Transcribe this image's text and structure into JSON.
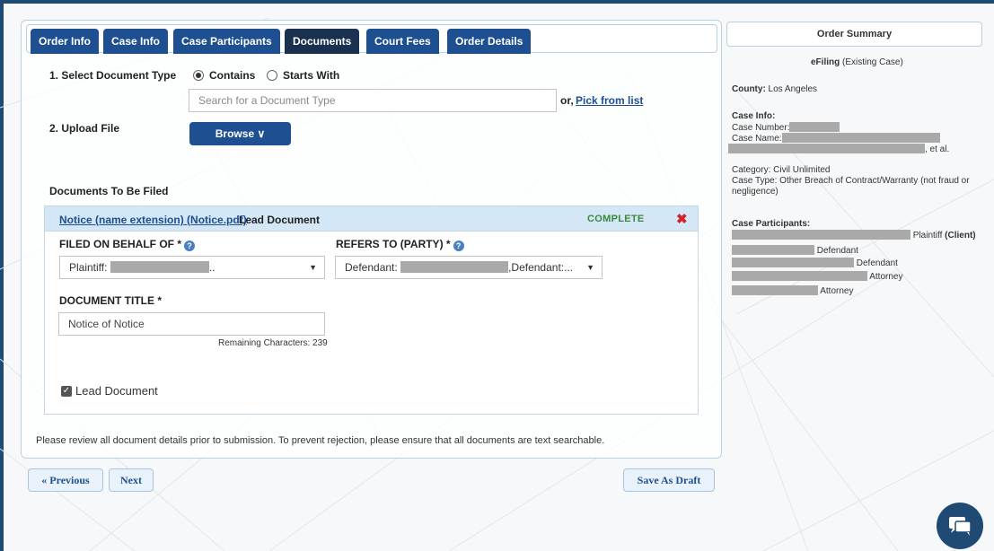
{
  "tabs": [
    {
      "label": "Order Info"
    },
    {
      "label": "Case Info"
    },
    {
      "label": "Case Participants"
    },
    {
      "label": "Documents"
    },
    {
      "label": "Court Fees"
    },
    {
      "label": "Order Details"
    }
  ],
  "active_tab": "Documents",
  "select_doc": {
    "label": "1. Select Document Type",
    "option_contains": "Contains",
    "option_starts_with": "Starts With",
    "search_placeholder": "Search for a Document Type",
    "or_text": "or,",
    "pick_link": "Pick from list"
  },
  "upload": {
    "label": "2. Upload File",
    "browse_label": "Browse ∨"
  },
  "documents": {
    "heading": "Documents To Be Filed",
    "item": {
      "file_link": "Notice (name extension) (Notice.pdf)",
      "lead_text": "Lead Document",
      "status": "COMPLETE",
      "remove_icon": "✖",
      "filed_on_behalf_label": "FILED ON BEHALF OF *",
      "filed_on_behalf_prefix": "Plaintiff:",
      "filed_on_behalf_suffix": "..",
      "refers_to_label": "REFERS TO (PARTY) *",
      "refers_to_prefix": "Defendant:",
      "refers_to_suffix": ",Defendant:...",
      "title_label": "DOCUMENT TITLE *",
      "title_value": "Notice of Notice",
      "remaining": "Remaining Characters: 239",
      "lead_checkbox_label": "Lead Document"
    }
  },
  "notice": "Please review all document details prior to submission. To prevent rejection, please ensure that all documents are text searchable.",
  "nav": {
    "previous": "« Previous",
    "next": "Next",
    "save_draft": "Save As Draft"
  },
  "summary": {
    "title": "Order Summary",
    "efiling_bold": "eFiling",
    "efiling_rest": " (Existing Case)",
    "county_label": "County:",
    "county_value": " Los Angeles",
    "case_info_label": "Case Info:",
    "case_number": "Case Number:",
    "case_name": "Case Name:",
    "et_al": ", et al.",
    "category": "Category: Civil Unlimited",
    "case_type_1": "Case Type: Other Breach of Contract/Warranty (not fraud or",
    "case_type_2": "negligence)",
    "participants_label": "Case Participants:",
    "p1_role": " Plaintiff ",
    "p1_client": "(Client)",
    "p2_role": " Defendant",
    "p3_role": " Defendant",
    "p4_role": " Attorney",
    "p5_role": " Attorney"
  }
}
